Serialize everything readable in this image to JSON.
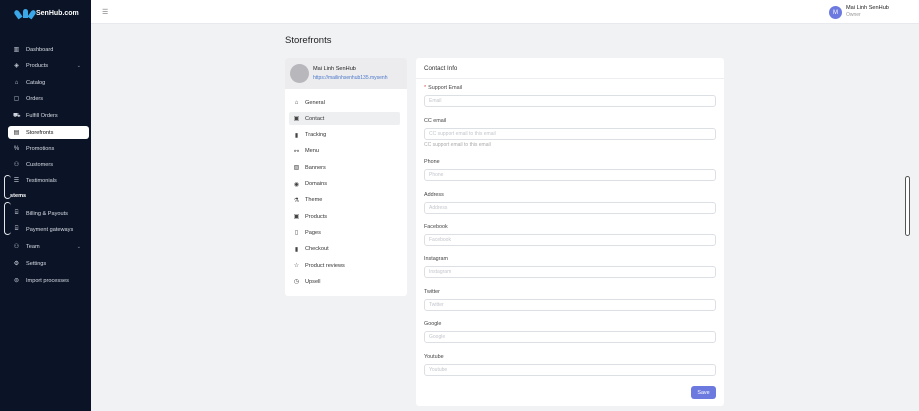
{
  "brand": {
    "name": "SenHub.com",
    "logo_icon": "lotus-logo-icon"
  },
  "sidebar": {
    "items": [
      {
        "label": "Dashboard",
        "icon": "bar-chart-icon",
        "glyph": "▥"
      },
      {
        "label": "Products",
        "icon": "box-icon",
        "glyph": "◈",
        "has_chevron": true
      },
      {
        "label": "Catalog",
        "icon": "bag-icon",
        "glyph": "⌂"
      },
      {
        "label": "Orders",
        "icon": "clipboard-icon",
        "glyph": "▢"
      },
      {
        "label": "Fulfill Orders",
        "icon": "truck-icon",
        "glyph": "⛟"
      },
      {
        "label": "Storefronts",
        "icon": "store-icon",
        "glyph": "▤",
        "active": true
      },
      {
        "label": "Promotions",
        "icon": "percent-icon",
        "glyph": "%"
      },
      {
        "label": "Customers",
        "icon": "users-icon",
        "glyph": "⚇"
      },
      {
        "label": "Testimonials",
        "icon": "chat-icon",
        "glyph": "☰"
      }
    ],
    "section_label": "stems",
    "items2": [
      {
        "label": "Billing & Payouts",
        "icon": "bank-icon",
        "glyph": "⌸"
      },
      {
        "label": "Payment gateways",
        "icon": "bank-icon",
        "glyph": "⌸"
      },
      {
        "label": "Team",
        "icon": "users-icon",
        "glyph": "⚇",
        "has_chevron": true
      },
      {
        "label": "Settings",
        "icon": "gear-icon",
        "glyph": "⚙"
      },
      {
        "label": "Import processes",
        "icon": "import-icon",
        "glyph": "⊜"
      }
    ]
  },
  "topbar": {
    "menu_icon": "hamburger-icon",
    "user": {
      "initial": "M",
      "name": "Mai Linh SenHub",
      "role": "Owner"
    }
  },
  "page": {
    "title": "Storefronts"
  },
  "store": {
    "name": "Mai Linh SenHub",
    "url": "https://mailinhsenhub135.mysenh"
  },
  "store_menu": [
    {
      "label": "General",
      "icon": "home-icon",
      "glyph": "⌂"
    },
    {
      "label": "Contact",
      "icon": "contact-card-icon",
      "glyph": "▣",
      "active": true
    },
    {
      "label": "Tracking",
      "icon": "barcode-icon",
      "glyph": "▮"
    },
    {
      "label": "Menu",
      "icon": "link-icon",
      "glyph": "⚯"
    },
    {
      "label": "Banners",
      "icon": "image-icon",
      "glyph": "▧"
    },
    {
      "label": "Domains",
      "icon": "globe-icon",
      "glyph": "◉"
    },
    {
      "label": "Theme",
      "icon": "flask-icon",
      "glyph": "⚗"
    },
    {
      "label": "Products",
      "icon": "box-icon",
      "glyph": "▣"
    },
    {
      "label": "Pages",
      "icon": "file-icon",
      "glyph": "▯"
    },
    {
      "label": "Checkout",
      "icon": "barcode-icon",
      "glyph": "▮"
    },
    {
      "label": "Product reviews",
      "icon": "star-icon",
      "glyph": "☆"
    },
    {
      "label": "Upsell",
      "icon": "clock-icon",
      "glyph": "◷"
    }
  ],
  "contact_form": {
    "title": "Contact Info",
    "fields": [
      {
        "label": "Support Email",
        "required": true,
        "placeholder": "Email",
        "value": ""
      },
      {
        "label": "CC email",
        "placeholder": "CC support email to this email",
        "help": "CC support email to this email",
        "value": ""
      },
      {
        "label": "Phone",
        "placeholder": "Phone",
        "value": ""
      },
      {
        "label": "Address",
        "placeholder": "Address",
        "value": ""
      },
      {
        "label": "Facebook",
        "placeholder": "Facebook",
        "value": ""
      },
      {
        "label": "Instagram",
        "placeholder": "Instagram",
        "value": ""
      },
      {
        "label": "Twitter",
        "placeholder": "Twitter",
        "value": ""
      },
      {
        "label": "Google",
        "placeholder": "Google",
        "value": ""
      },
      {
        "label": "Youtube",
        "placeholder": "Youtube",
        "value": ""
      }
    ],
    "save_label": "Save"
  },
  "colors": {
    "sidebar_bg": "#0b1426",
    "accent": "#6c7ae0",
    "link": "#4a78c9",
    "required": "#e04545"
  }
}
